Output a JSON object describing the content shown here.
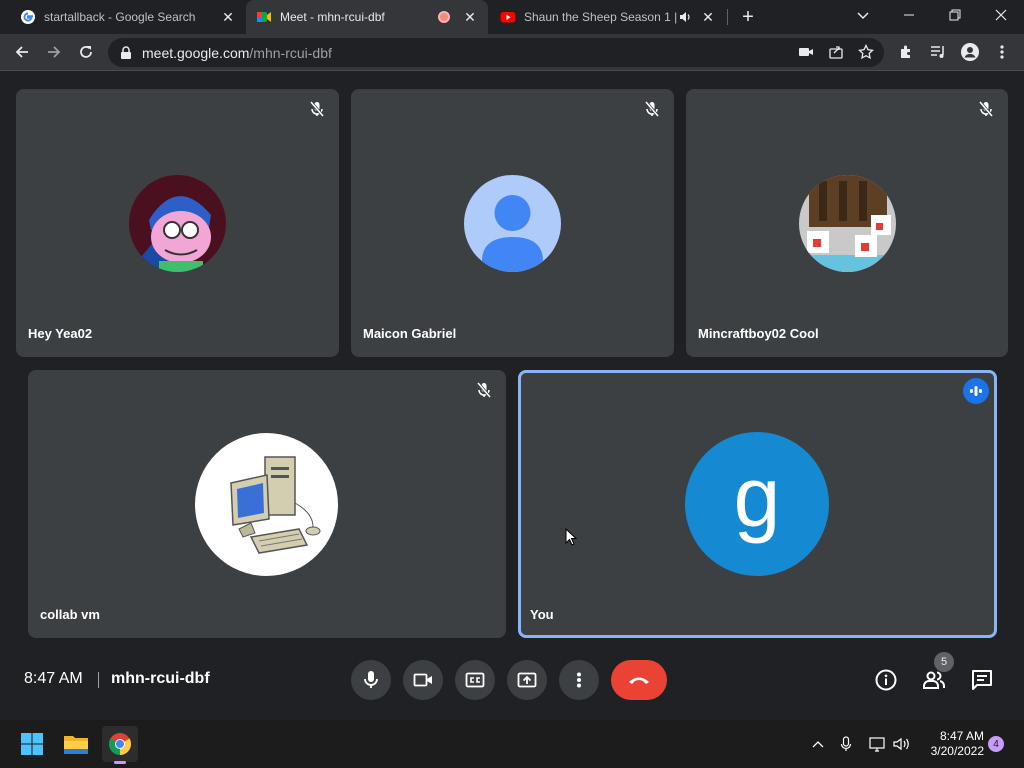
{
  "browser": {
    "tabs": [
      {
        "title": "startallback - Google Search",
        "favicon": "google-icon"
      },
      {
        "title": "Meet - mhn-rcui-dbf",
        "favicon": "meet-icon",
        "recording": true
      },
      {
        "title": "Shaun the Sheep Season 1 | ",
        "favicon": "youtube-icon",
        "audio": true
      }
    ],
    "new_tab": "+",
    "url_host": "meet.google.com",
    "url_path": "/mhn-rcui-dbf"
  },
  "participants": [
    {
      "name": "Hey Yea02",
      "muted": true
    },
    {
      "name": "Maicon Gabriel",
      "muted": true
    },
    {
      "name": "Mincraftboy02 Cool",
      "muted": true
    },
    {
      "name": "collab vm",
      "muted": true
    },
    {
      "name": "You",
      "muted": false,
      "avatar_letter": "g",
      "avatar_color": "#1589d1",
      "speaking": true
    }
  ],
  "meeting": {
    "time": "8:47 AM",
    "code": "mhn-rcui-dbf",
    "participant_count": "5"
  },
  "taskbar": {
    "time": "8:47 AM",
    "date": "3/20/2022",
    "notifications": "4"
  },
  "colors": {
    "accent": "#8ab4f8",
    "hangup": "#ea4335",
    "tile": "#3c4043"
  }
}
